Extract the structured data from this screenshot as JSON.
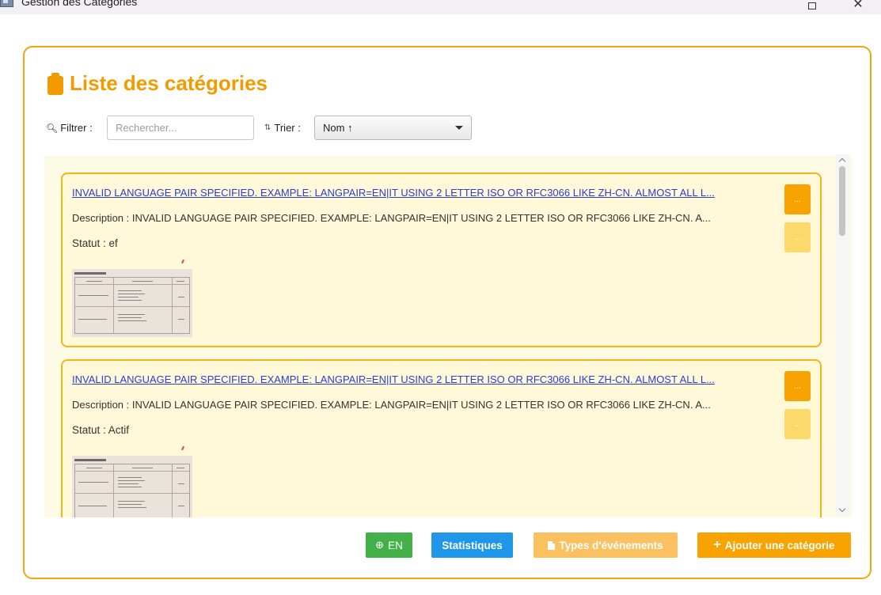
{
  "window": {
    "title": "Gestion des Catégories"
  },
  "page": {
    "title": "Liste des catégories"
  },
  "filter": {
    "label": "Filtrer :",
    "placeholder": "Rechercher...",
    "value": ""
  },
  "sort": {
    "label": "Trier :",
    "selected": "Nom ↑"
  },
  "categories": [
    {
      "name": "INVALID LANGUAGE PAIR SPECIFIED. EXAMPLE: LANGPAIR=EN|IT USING 2 LETTER ISO OR RFC3066 LIKE ZH-CN. ALMOST ALL L...",
      "description": "Description : INVALID LANGUAGE PAIR SPECIFIED. EXAMPLE: LANGPAIR=EN|IT USING 2 LETTER ISO OR RFC3066 LIKE ZH-CN. A...",
      "status": "Statut : ef",
      "edit_label": "...",
      "delete_label": "..."
    },
    {
      "name": "INVALID LANGUAGE PAIR SPECIFIED. EXAMPLE: LANGPAIR=EN|IT USING 2 LETTER ISO OR RFC3066 LIKE ZH-CN. ALMOST ALL L...",
      "description": "Description : INVALID LANGUAGE PAIR SPECIFIED. EXAMPLE: LANGPAIR=EN|IT USING 2 LETTER ISO OR RFC3066 LIKE ZH-CN. A...",
      "status": "Statut : Actif",
      "edit_label": "...",
      "delete_label": "..."
    }
  ],
  "footer": {
    "lang_label": "EN",
    "stats_label": "Statistiques",
    "types_label": "Types d'événements",
    "add_label": "Ajouter une catégorie"
  },
  "colors": {
    "accent": "#f29b00",
    "card_background": "#fff8d9",
    "link": "#2b3ecf",
    "lang_button": "#43b04a",
    "stats_button": "#1f96e8",
    "types_button": "#fbc060",
    "add_button": "#f8a300"
  },
  "icons": {
    "title_icon": "clipboard-icon",
    "filter_icon": "search-icon",
    "sort_icon": "sort-icon",
    "lang_icon": "globe-icon",
    "types_icon": "document-icon",
    "add_icon": "plus-icon"
  }
}
